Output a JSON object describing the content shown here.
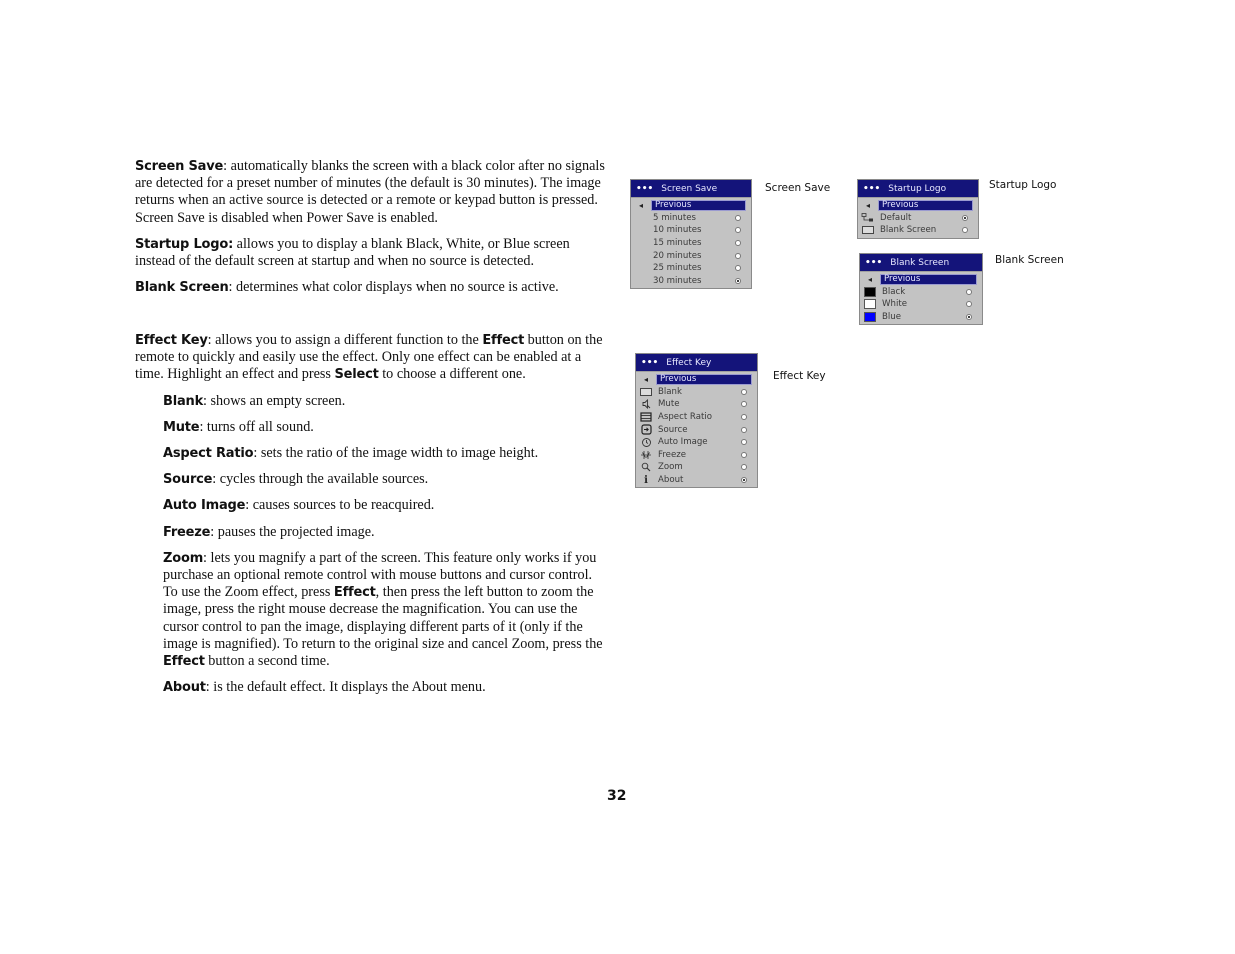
{
  "section1": {
    "paragraphs": [
      {
        "term": "Screen Save",
        "text": ": automatically blanks the screen with a black color after no signals are detected for a preset number of minutes (the default is 30 minutes). The image returns when an active source is detected or a remote or keypad button is pressed. Screen Save is disabled when Power Save is enabled."
      },
      {
        "term": "Startup Logo:",
        "text": " allows you to display a blank Black, White, or Blue screen instead of the default screen at startup and when no source is detected."
      },
      {
        "term": "Blank Screen",
        "text": ": determines what color displays when no source is active."
      }
    ]
  },
  "section2": {
    "intro": {
      "term": "Effect Key",
      "text_a": ": allows you to assign a different function to the ",
      "bold_a": "Effect",
      "text_b": " button on the remote to quickly and easily use the effect. Only one effect can be enabled at a time. Highlight an effect and press ",
      "bold_b": "Select",
      "text_c": " to choose a different one."
    },
    "items": [
      {
        "term": "Blank",
        "text": ": shows an empty screen."
      },
      {
        "term": "Mute",
        "text": ": turns off all sound."
      },
      {
        "term": "Aspect Ratio",
        "text": ": sets the ratio of the image width to image height."
      },
      {
        "term": "Source",
        "text": ": cycles through the available sources."
      },
      {
        "term": "Auto Image",
        "text": ": causes sources to be reacquired."
      },
      {
        "term": "Freeze",
        "text": ": pauses the projected image."
      }
    ],
    "zoom": {
      "term": "Zoom",
      "text_a": ": lets you magnify a part of the screen. This feature only works if you purchase an optional remote control with mouse buttons and cursor control. To use the Zoom effect, press ",
      "bold_a": "Effect",
      "text_b": ", then press the left button to zoom the image, press the right mouse decrease the magnification. You can use the cursor control to pan the image, displaying different parts of it (only if the image is magnified). To return to the original size and cancel Zoom, press the ",
      "bold_b": "Effect",
      "text_c": " button a second time."
    },
    "about": {
      "term": "About",
      "text": ": is the default effect. It displays the About menu."
    }
  },
  "menus": {
    "screen_save": {
      "title": "Screen Save",
      "previous": "Previous",
      "caption": "Screen Save",
      "options": [
        {
          "label": "5 minutes",
          "selected": false
        },
        {
          "label": "10 minutes",
          "selected": false
        },
        {
          "label": "15 minutes",
          "selected": false
        },
        {
          "label": "20 minutes",
          "selected": false
        },
        {
          "label": "25 minutes",
          "selected": false
        },
        {
          "label": "30 minutes",
          "selected": true
        }
      ]
    },
    "startup_logo": {
      "title": "Startup Logo",
      "previous": "Previous",
      "caption": "Startup Logo",
      "options": [
        {
          "label": "Default",
          "icon": "logo-icon",
          "selected": true
        },
        {
          "label": "Blank Screen",
          "icon": "blank-screen-icon",
          "selected": false
        }
      ]
    },
    "blank_screen": {
      "title": "Blank Screen",
      "previous": "Previous",
      "caption": "Blank Screen",
      "options": [
        {
          "label": "Black",
          "color": "#000000",
          "selected": false
        },
        {
          "label": "White",
          "color": "#ffffff",
          "selected": false
        },
        {
          "label": "Blue",
          "color": "#0000ff",
          "selected": true
        }
      ]
    },
    "effect_key": {
      "title": "Effect Key",
      "previous": "Previous",
      "caption": "Effect Key",
      "options": [
        {
          "label": "Blank",
          "icon": "blank-icon",
          "selected": false
        },
        {
          "label": "Mute",
          "icon": "mute-icon",
          "selected": false
        },
        {
          "label": "Aspect Ratio",
          "icon": "aspect-ratio-icon",
          "selected": false
        },
        {
          "label": "Source",
          "icon": "source-icon",
          "selected": false
        },
        {
          "label": "Auto Image",
          "icon": "auto-image-icon",
          "selected": false
        },
        {
          "label": "Freeze",
          "icon": "freeze-icon",
          "selected": false
        },
        {
          "label": "Zoom",
          "icon": "zoom-icon",
          "selected": false
        },
        {
          "label": "About",
          "icon": "about-icon",
          "selected": true
        }
      ]
    }
  },
  "colors": {
    "menu_title_bg": "#14147a",
    "menu_bg": "#c3c3c3"
  },
  "page_number": "32"
}
